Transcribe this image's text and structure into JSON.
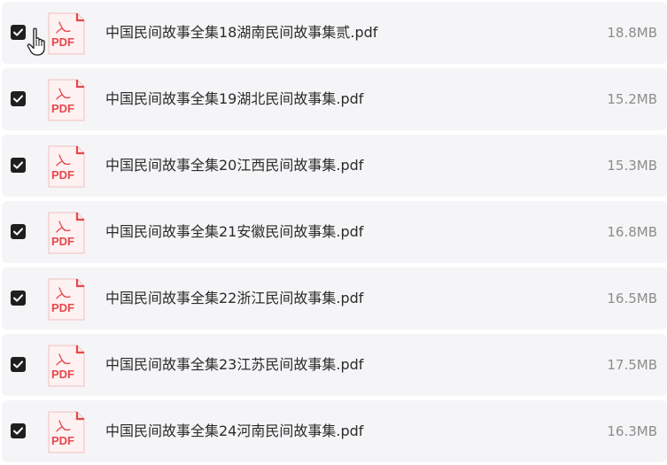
{
  "files": [
    {
      "name": "中国民间故事全集18湖南民间故事集贰.pdf",
      "size": "18.8MB",
      "type_label": "PDF",
      "checked": true
    },
    {
      "name": "中国民间故事全集19湖北民间故事集.pdf",
      "size": "15.2MB",
      "type_label": "PDF",
      "checked": true
    },
    {
      "name": "中国民间故事全集20江西民间故事集.pdf",
      "size": "15.3MB",
      "type_label": "PDF",
      "checked": true
    },
    {
      "name": "中国民间故事全集21安徽民间故事集.pdf",
      "size": "16.8MB",
      "type_label": "PDF",
      "checked": true
    },
    {
      "name": "中国民间故事全集22浙江民间故事集.pdf",
      "size": "16.5MB",
      "type_label": "PDF",
      "checked": true
    },
    {
      "name": "中国民间故事全集23江苏民间故事集.pdf",
      "size": "17.5MB",
      "type_label": "PDF",
      "checked": true
    },
    {
      "name": "中国民间故事全集24河南民间故事集.pdf",
      "size": "16.3MB",
      "type_label": "PDF",
      "checked": true
    }
  ],
  "icons": {
    "checkbox": "checkbox-checked-icon",
    "file": "pdf-file-icon",
    "cursor": "hand-pointer-icon"
  },
  "colors": {
    "row_background": "#f5f5f7",
    "checkbox_fill": "#1f1f1f",
    "pdf_red": "#e5484d",
    "pdf_page": "#fdf1f1",
    "name_text": "#2b2b2b",
    "size_text": "#8c8c8c"
  }
}
